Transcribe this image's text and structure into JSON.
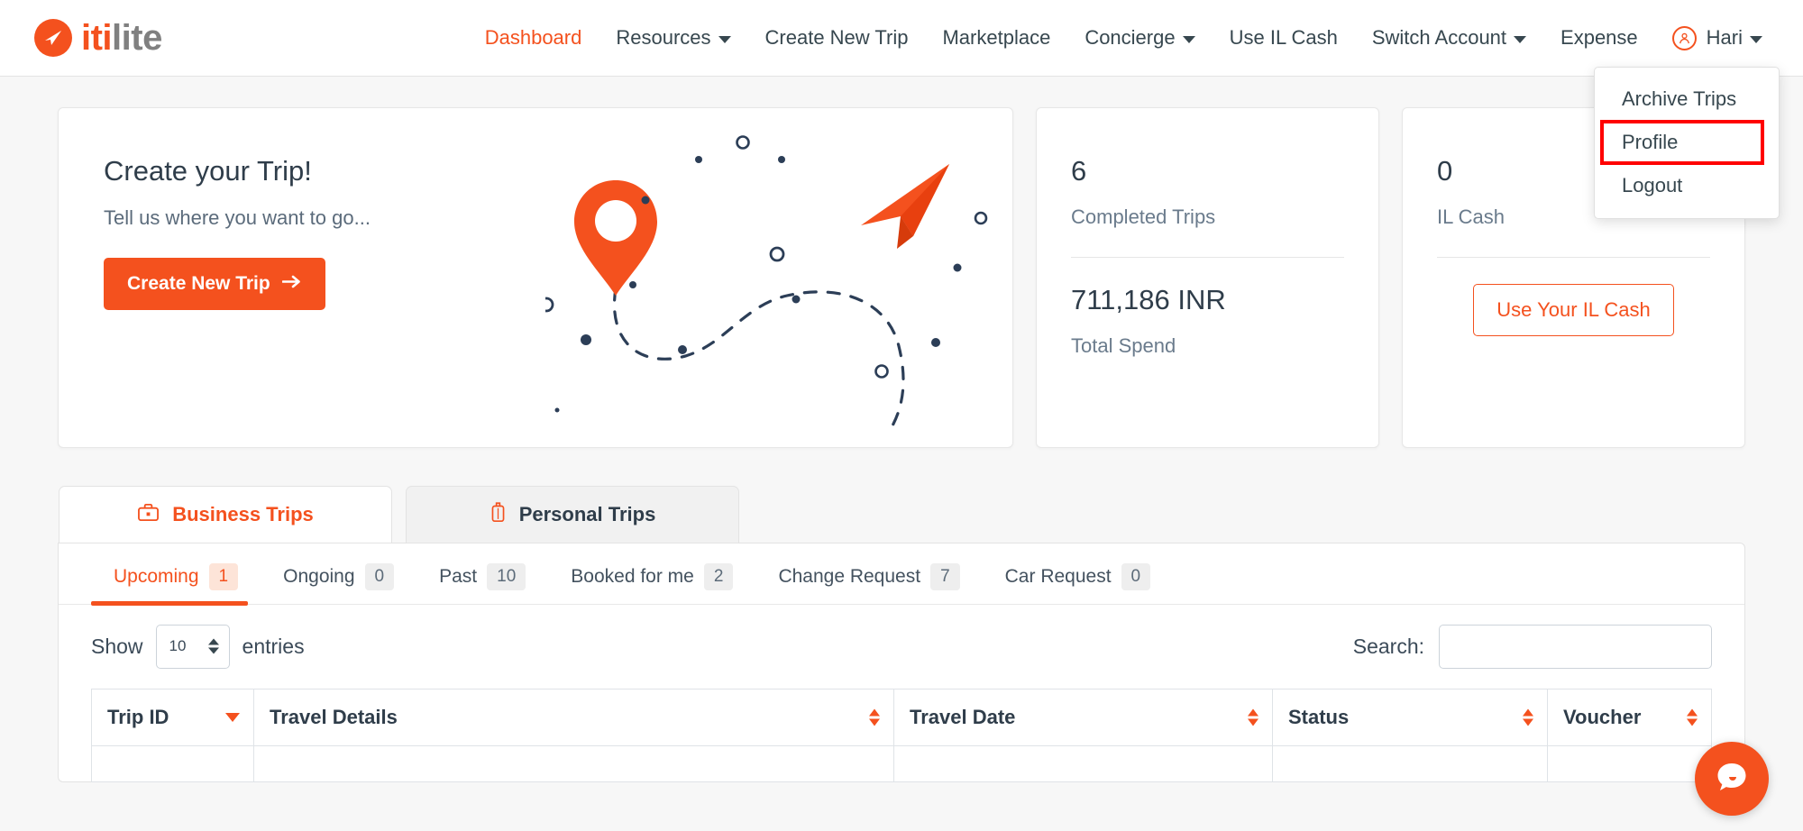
{
  "brand": {
    "part1": "iti",
    "part2": "lite",
    "icon": "paper-plane-logo-icon"
  },
  "nav": {
    "items": [
      {
        "label": "Dashboard",
        "active": true,
        "caret": false
      },
      {
        "label": "Resources",
        "active": false,
        "caret": true
      },
      {
        "label": "Create New Trip",
        "active": false,
        "caret": false
      },
      {
        "label": "Marketplace",
        "active": false,
        "caret": false
      },
      {
        "label": "Concierge",
        "active": false,
        "caret": true
      },
      {
        "label": "Use IL Cash",
        "active": false,
        "caret": false
      },
      {
        "label": "Switch Account",
        "active": false,
        "caret": true
      },
      {
        "label": "Expense",
        "active": false,
        "caret": false
      }
    ],
    "user": {
      "name": "Hari",
      "icon": "user-circle-icon"
    }
  },
  "user_menu": {
    "items": [
      {
        "label": "Archive Trips",
        "highlighted": false
      },
      {
        "label": "Profile",
        "highlighted": true
      },
      {
        "label": "Logout",
        "highlighted": false
      }
    ]
  },
  "hero": {
    "title": "Create your Trip!",
    "subtitle": "Tell us where you want to go...",
    "button_label": "Create New Trip",
    "button_icon": "arrow-right-icon",
    "illustration": "map-pin-paper-plane-dashed-route"
  },
  "stats": {
    "completed": {
      "value": "6",
      "label": "Completed Trips"
    },
    "spend": {
      "value": "711,186 INR",
      "label": "Total Spend"
    },
    "ilcash": {
      "value": "0",
      "label": "IL Cash",
      "button_label": "Use Your IL Cash"
    }
  },
  "trip_tabs": [
    {
      "label": "Business Trips",
      "icon": "briefcase-icon",
      "active": true
    },
    {
      "label": "Personal Trips",
      "icon": "suitcase-icon",
      "active": false
    }
  ],
  "subtabs": [
    {
      "label": "Upcoming",
      "count": "1",
      "active": true
    },
    {
      "label": "Ongoing",
      "count": "0",
      "active": false
    },
    {
      "label": "Past",
      "count": "10",
      "active": false
    },
    {
      "label": "Booked for me",
      "count": "2",
      "active": false
    },
    {
      "label": "Change Request",
      "count": "7",
      "active": false
    },
    {
      "label": "Car Request",
      "count": "0",
      "active": false
    }
  ],
  "controls": {
    "show_label": "Show",
    "entries_label": "entries",
    "page_size": "10",
    "search_label": "Search:",
    "search_value": "",
    "search_placeholder": ""
  },
  "table": {
    "columns": [
      {
        "label": "Trip ID",
        "sort": "desc"
      },
      {
        "label": "Travel Details",
        "sort": "both"
      },
      {
        "label": "Travel Date",
        "sort": "both"
      },
      {
        "label": "Status",
        "sort": "both"
      },
      {
        "label": "Voucher",
        "sort": "both"
      }
    ]
  },
  "chat": {
    "icon": "chat-bubble-icon"
  },
  "colors": {
    "accent": "#f4511e",
    "text": "#2f3d4a",
    "muted": "#6a7b8c",
    "highlight": "#ff0000",
    "illustration_dark": "#2c3e57"
  }
}
